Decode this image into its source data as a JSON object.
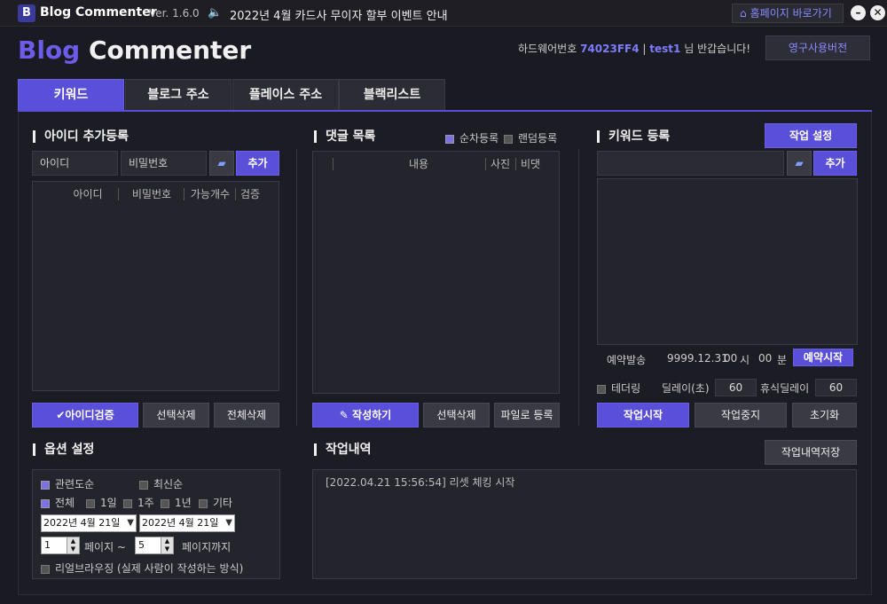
{
  "titlebar": {
    "logo_letter": "B",
    "app_name": "Blog Commenter",
    "version": "Ver. 1.6.0",
    "notice": "2022년 4월 카드사 무이자 할부 이벤트 안내",
    "home_label": "홈페이지 바로가기",
    "minimize": "–",
    "close": "✕"
  },
  "header": {
    "brand_part1": "Blog",
    "brand_part2": " Commenter",
    "hw_label": "하드웨어번호",
    "hw_id": "74023FF4",
    "sep": "|",
    "user": "test1",
    "greeting": "님 반갑습니다!",
    "license_button": "영구사용버전"
  },
  "tabs": [
    {
      "label": "키워드",
      "active": true
    },
    {
      "label": "블로그 주소"
    },
    {
      "label": "플레이스 주소"
    },
    {
      "label": "블랙리스트"
    }
  ],
  "id_section": {
    "title": "아이디 추가등록",
    "id_placeholder": "아이디",
    "pw_placeholder": "비밀번호",
    "add_button": "추가",
    "columns": [
      "아이디",
      "비밀번호",
      "가능개수",
      "검증"
    ],
    "verify_button": "✔아이디검증",
    "delete_selected": "선택삭제",
    "delete_all": "전체삭제"
  },
  "comment_section": {
    "title": "댓글 목록",
    "sequential_label": "순차등록",
    "random_label": "랜덤등록",
    "sequential_checked": true,
    "random_checked": false,
    "columns": [
      "내용",
      "사진",
      "비댓"
    ],
    "write_button": "✎ 작성하기",
    "delete_selected": "선택삭제",
    "file_register": "파일로 등록"
  },
  "keyword_section": {
    "title": "키워드 등록",
    "settings_button": "작업 설정",
    "add_button": "추가",
    "reserve_label": "예약발송",
    "reserve_date": "9999.12.31",
    "reserve_hour": "00",
    "hour_unit": "시",
    "reserve_min": "00",
    "min_unit": "분",
    "reserve_start": "예약시작",
    "tethering_label": "테더링",
    "delay_label": "딜레이(초)",
    "delay_value": "60",
    "rest_delay_label": "휴식딜레이",
    "rest_delay_value": "60",
    "start_button": "작업시작",
    "stop_button": "작업중지",
    "reset_button": "초기화"
  },
  "options": {
    "title": "옵션 설정",
    "sort_relevance": "관련도순",
    "sort_recent": "최신순",
    "relevance_checked": true,
    "recent_checked": false,
    "range_all": "전체",
    "range_1d": "1일",
    "range_1w": "1주",
    "range_1y": "1년",
    "range_other": "기타",
    "all_checked": true,
    "date_from": "2022년   4월 21일",
    "date_to": "2022년   4월 21일",
    "page_from": "1",
    "page_sep": "페이지 ~",
    "page_to": "5",
    "page_until": "페이지까지",
    "real_browsing": "리얼브라우징 (실제 사람이 작성하는 방식)"
  },
  "log_section": {
    "title": "작업내역",
    "save_button": "작업내역저장",
    "entries": [
      "[2022.04.21 15:56:54]   리셋 체킹 시작"
    ]
  }
}
